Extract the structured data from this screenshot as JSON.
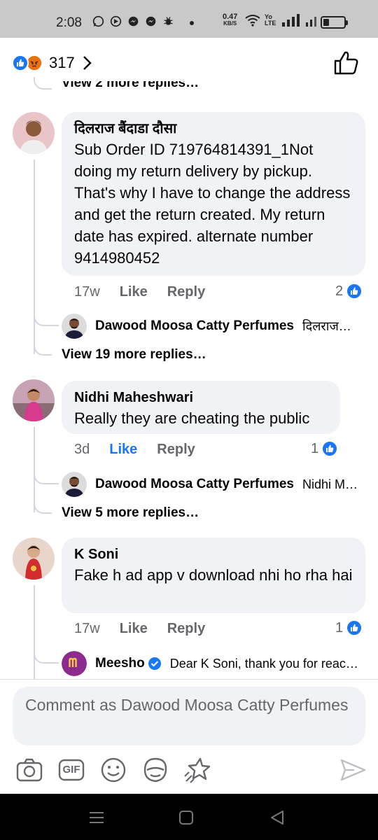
{
  "status_bar": {
    "time": "2:08",
    "net_speed_value": "0.47",
    "net_speed_unit": "KB/S",
    "volte_label": "Yo LTE",
    "battery_level": 0.3
  },
  "reactions": {
    "count": "317",
    "icons": [
      "like-icon",
      "angry-icon"
    ]
  },
  "thread": {
    "truncated_link": "View 2 more replies…",
    "comments": [
      {
        "author": "दिलराज बैंदाडा दौसा",
        "text": "Sub Order ID 719764814391_1Not doing my return delivery by pickup. That's why I have to change the address and get the return created. My return date has expired.  alternate number 9414980452",
        "time": "17w",
        "like_label": "Like",
        "reply_label": "Reply",
        "like_count": "2",
        "reply_preview": {
          "author": "Dawood Moosa Catty Perfumes",
          "snippet": "दिलराज…"
        },
        "view_more": "View 19 more replies…"
      },
      {
        "author": "Nidhi Maheshwari",
        "text": "Really they are cheating the public",
        "time": "3d",
        "like_label": "Like",
        "reply_label": "Reply",
        "like_count": "1",
        "reply_preview": {
          "author": "Dawood Moosa Catty Perfumes",
          "snippet": "Nidhi M…"
        },
        "view_more": "View 5 more replies…"
      },
      {
        "author": "K Soni",
        "text": "Fake h  ad app v download nhi ho rha hai",
        "time": "17w",
        "like_label": "Like",
        "reply_label": "Reply",
        "like_count": "1",
        "reply_preview": {
          "author": "Meesho",
          "snippet": "Dear K Soni, thank you for reac…"
        }
      }
    ]
  },
  "composer": {
    "placeholder": "Comment as Dawood Moosa Catty Perfumes",
    "toolbar_icons": [
      "camera-icon",
      "gif-icon",
      "emoji-icon",
      "sticker-icon",
      "avatar-sticker-icon"
    ],
    "gif_label": "GIF"
  },
  "colors": {
    "accent": "#1877f2",
    "bubble_bg": "#f0f2f5",
    "meta_text": "#65676b",
    "meesho_brand": "#8c2a8f"
  }
}
